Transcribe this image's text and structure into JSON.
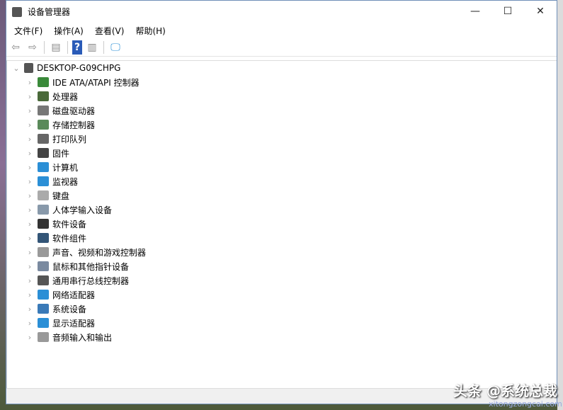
{
  "window": {
    "title": "设备管理器",
    "minimize": "—",
    "maximize": "☐",
    "close": "✕"
  },
  "menu": [
    "文件(F)",
    "操作(A)",
    "查看(V)",
    "帮助(H)"
  ],
  "toolbar": [
    {
      "icon": "back-icon",
      "glyph": "⇦"
    },
    {
      "icon": "forward-icon",
      "glyph": "⇨"
    },
    {
      "icon": "show-hide-console-tree-icon",
      "glyph": "▤"
    },
    {
      "icon": "help-icon",
      "glyph": "?"
    },
    {
      "icon": "properties-icon",
      "glyph": "▥"
    },
    {
      "icon": "scan-hardware-icon",
      "glyph": "🖵"
    }
  ],
  "tree": {
    "root": "DESKTOP-G09CHPG",
    "items": [
      {
        "label": "IDE ATA/ATAPI 控制器",
        "color": "#3a8a3a"
      },
      {
        "label": "处理器",
        "color": "#4a6a3a"
      },
      {
        "label": "磁盘驱动器",
        "color": "#777777"
      },
      {
        "label": "存储控制器",
        "color": "#5a8a5a"
      },
      {
        "label": "打印队列",
        "color": "#666666"
      },
      {
        "label": "固件",
        "color": "#444444"
      },
      {
        "label": "计算机",
        "color": "#2b8fd6"
      },
      {
        "label": "监视器",
        "color": "#2b8fd6"
      },
      {
        "label": "键盘",
        "color": "#aaaaaa"
      },
      {
        "label": "人体学输入设备",
        "color": "#8899aa"
      },
      {
        "label": "软件设备",
        "color": "#333333"
      },
      {
        "label": "软件组件",
        "color": "#335577"
      },
      {
        "label": "声音、视频和游戏控制器",
        "color": "#999999"
      },
      {
        "label": "鼠标和其他指针设备",
        "color": "#7a8aa0"
      },
      {
        "label": "通用串行总线控制器",
        "color": "#555555"
      },
      {
        "label": "网络适配器",
        "color": "#2b8fd6"
      },
      {
        "label": "系统设备",
        "color": "#3a7ab8"
      },
      {
        "label": "显示适配器",
        "color": "#2b8fd6"
      },
      {
        "label": "音频输入和输出",
        "color": "#999999"
      }
    ]
  },
  "watermark": {
    "text": "头条 @系统总裁",
    "site": "xitongzongcai.com"
  }
}
